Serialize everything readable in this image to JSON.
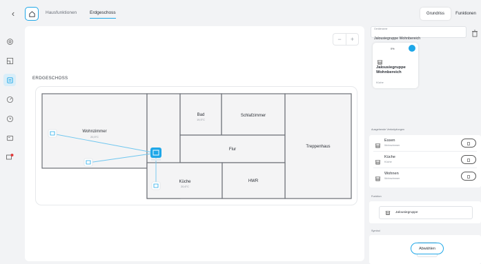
{
  "nav": {
    "back_icon": "chevron-left-icon",
    "home_icon": "house-icon",
    "tabs": [
      {
        "label": "Hausfunktionen",
        "active": false
      },
      {
        "label": "Erdgeschoss",
        "active": true
      }
    ],
    "view_toggle": [
      {
        "label": "Grundriss",
        "active": true
      },
      {
        "label": "Funktionen",
        "active": false
      }
    ]
  },
  "sidebar": {
    "items": [
      {
        "icon": "settings-icon",
        "active": false
      },
      {
        "icon": "floorplan-icon",
        "active": false
      },
      {
        "icon": "device-icon",
        "active": true
      },
      {
        "icon": "compass-icon",
        "active": false
      },
      {
        "icon": "clock-icon",
        "active": false
      },
      {
        "icon": "screen-icon",
        "active": false
      },
      {
        "icon": "network-alert-icon",
        "active": false
      }
    ]
  },
  "floorplan": {
    "title": "ERDGESCHOSS",
    "zoom_out": "−",
    "zoom_in": "+",
    "rooms": [
      {
        "name": "Wohnzimmer",
        "temp": "20,5°C"
      },
      {
        "name": "Bad",
        "temp": "19,5°C"
      },
      {
        "name": "Schlafzimmer",
        "temp": ""
      },
      {
        "name": "Flur",
        "temp": ""
      },
      {
        "name": "Treppenhaus",
        "temp": ""
      },
      {
        "name": "Küche",
        "temp": "20,6°C"
      },
      {
        "name": "HWR",
        "temp": ""
      }
    ]
  },
  "panel": {
    "name_field": {
      "label": "Geräte­name",
      "value": "Jalousiegruppe Wohnbereich"
    },
    "preview": {
      "percent": "0%",
      "title": "Jalousiegruppe Wohnbereich",
      "room": "Küche"
    },
    "connections_title": "Ausgehende Verknüpfungen",
    "connections": [
      {
        "name": "Essen",
        "room": "Wohnzimmer"
      },
      {
        "name": "Küche",
        "room": "Küche"
      },
      {
        "name": "Wohnen",
        "room": "Wohnzimmer"
      }
    ],
    "function_title": "Funktion",
    "function_value": "Jalousiegruppe",
    "symbol_title": "Symbol",
    "deselect_label": "Abwählen"
  },
  "colors": {
    "accent": "#1ea7e8",
    "device_fill": "#1ea7e8",
    "link_line": "#6ec6ef"
  }
}
